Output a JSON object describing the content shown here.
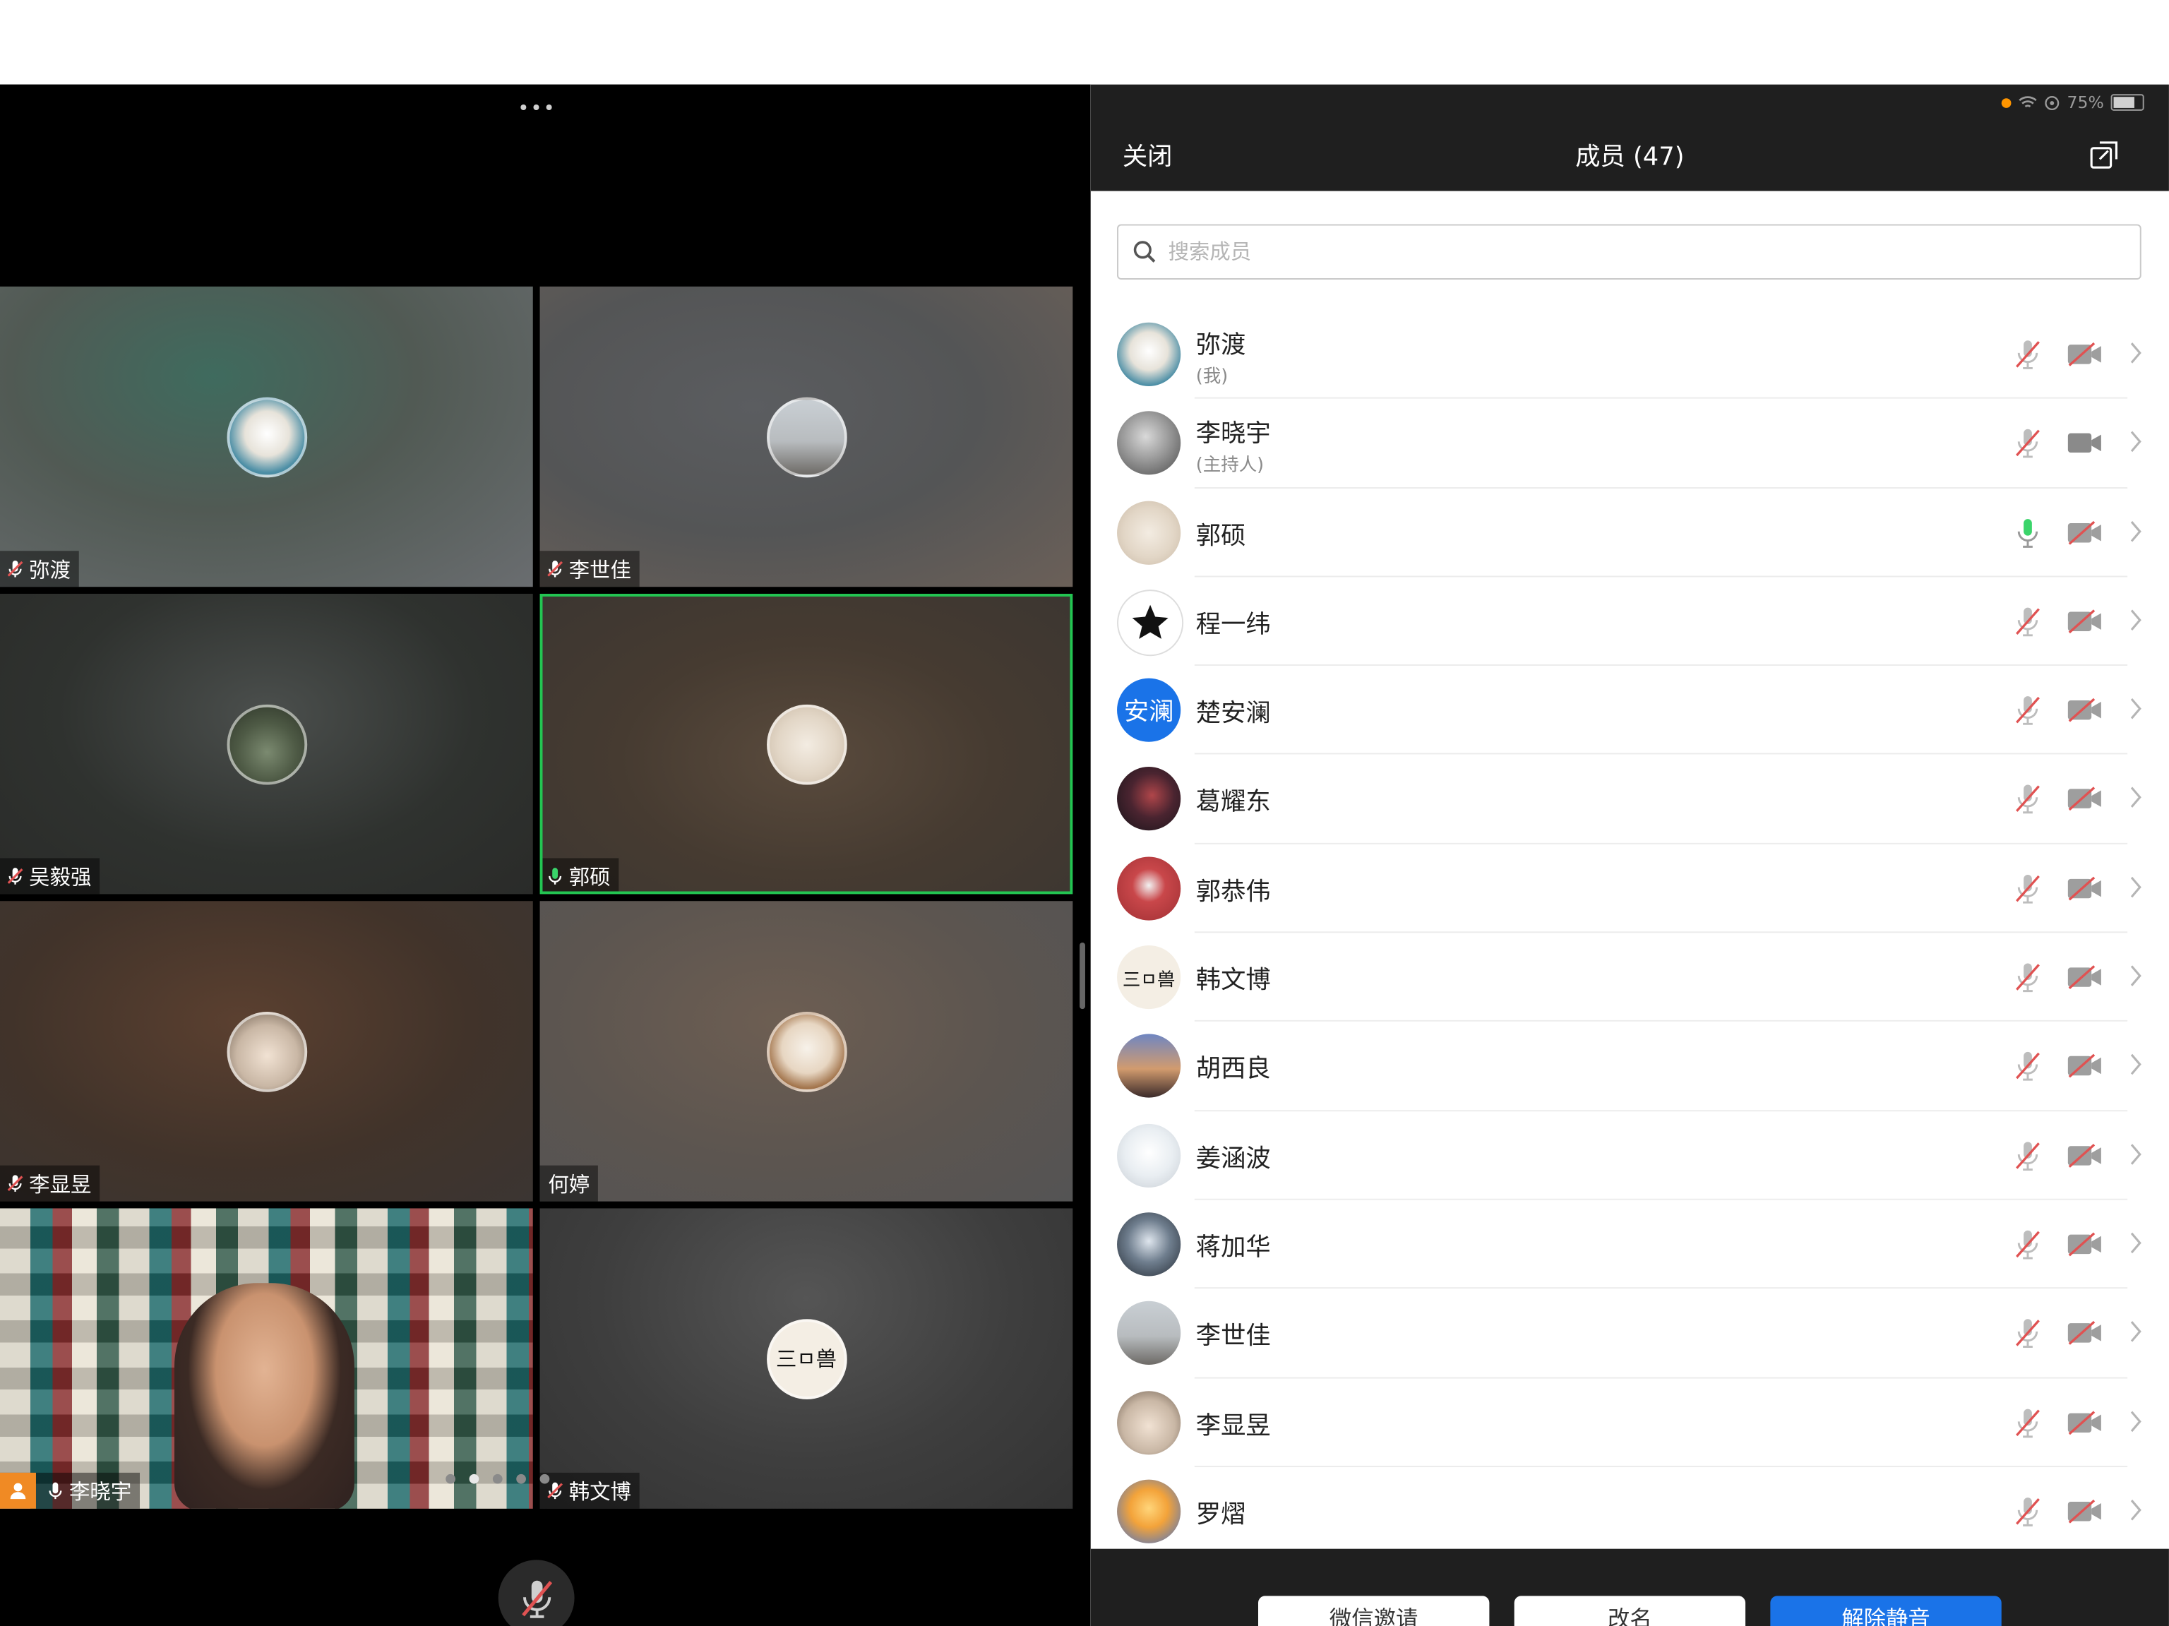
{
  "meeting": {
    "menu_glyph": "•••",
    "tiles": [
      {
        "name": "弥渡",
        "mic": "muted"
      },
      {
        "name": "李世佳",
        "mic": "muted"
      },
      {
        "name": "吴毅强",
        "mic": "muted"
      },
      {
        "name": "郭硕",
        "mic": "on",
        "active": true
      },
      {
        "name": "李显昱",
        "mic": "muted"
      },
      {
        "name": "何婷",
        "mic": "none"
      },
      {
        "name": "李晓宇",
        "mic": "on",
        "host": true
      },
      {
        "name": "韩文博",
        "mic": "muted"
      }
    ]
  },
  "status": {
    "battery": "75%"
  },
  "panel": {
    "close_label": "关闭",
    "title": "成员 (47)",
    "search_placeholder": "搜索成员",
    "members": [
      {
        "name": "弥渡",
        "sub": "(我)",
        "mic": "muted",
        "cam": "off"
      },
      {
        "name": "李晓宇",
        "sub": "(主持人)",
        "mic": "muted",
        "cam": "on"
      },
      {
        "name": "郭硕",
        "sub": "",
        "mic": "on",
        "cam": "off"
      },
      {
        "name": "程一纬",
        "sub": "",
        "mic": "muted",
        "cam": "off"
      },
      {
        "name": "楚安澜",
        "sub": "",
        "mic": "muted",
        "cam": "off",
        "avatar_text": "安澜"
      },
      {
        "name": "葛耀东",
        "sub": "",
        "mic": "muted",
        "cam": "off"
      },
      {
        "name": "郭恭伟",
        "sub": "",
        "mic": "muted",
        "cam": "off"
      },
      {
        "name": "韩文博",
        "sub": "",
        "mic": "muted",
        "cam": "off"
      },
      {
        "name": "胡西良",
        "sub": "",
        "mic": "muted",
        "cam": "off"
      },
      {
        "name": "姜涵波",
        "sub": "",
        "mic": "muted",
        "cam": "off"
      },
      {
        "name": "蒋加华",
        "sub": "",
        "mic": "muted",
        "cam": "off"
      },
      {
        "name": "李世佳",
        "sub": "",
        "mic": "muted",
        "cam": "off"
      },
      {
        "name": "李显昱",
        "sub": "",
        "mic": "muted",
        "cam": "off"
      },
      {
        "name": "罗熠",
        "sub": "",
        "mic": "muted",
        "cam": "off"
      }
    ],
    "buttons": [
      "微信邀请",
      "改名",
      "解除静音"
    ]
  },
  "colors": {
    "accent": "#1a73e8",
    "active_speaker": "#23c552",
    "muted": "#e05252",
    "host": "#f08a24"
  }
}
